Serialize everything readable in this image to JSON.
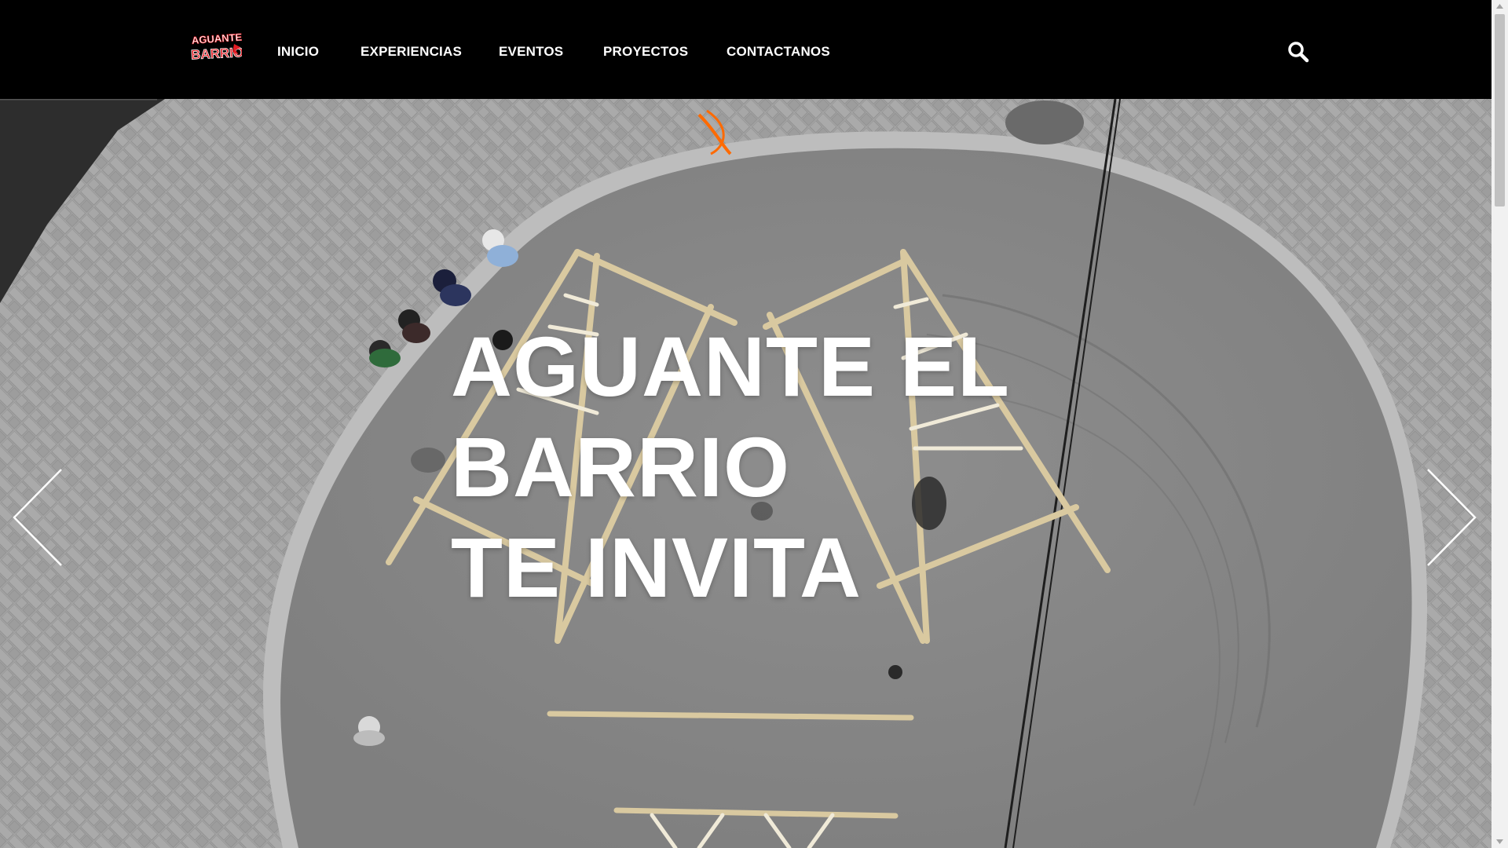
{
  "brand": {
    "logo_text_top": "AGUANTE",
    "logo_text_bottom": "BARRIO",
    "logo_color": "#e31b23"
  },
  "nav": {
    "items": [
      {
        "label": "INICIO"
      },
      {
        "label": "EXPERIENCIAS"
      },
      {
        "label": "EVENTOS"
      },
      {
        "label": "PROYECTOS"
      },
      {
        "label": "CONTACTANOS"
      }
    ],
    "search_icon": "search-icon"
  },
  "hero": {
    "title_lines": [
      "AGUANTE EL",
      "BARRIO",
      "TE INVITA"
    ],
    "prev_icon": "chevron-left-icon",
    "next_icon": "chevron-right-icon"
  },
  "colors": {
    "header_bg": "#000000",
    "nav_text": "#ffffff",
    "asphalt": "#8a8a8a",
    "pavers": "#a9a9a9"
  }
}
